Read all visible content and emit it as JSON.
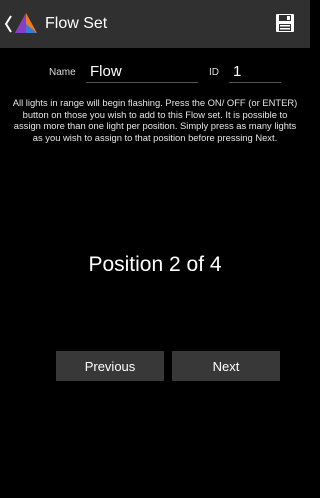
{
  "app_bar": {
    "title": "Flow Set",
    "back_icon": "chevron-left-icon",
    "logo_icon": "app-logo-icon",
    "save_icon": "save-icon"
  },
  "form": {
    "name_label": "Name",
    "name_value": "Flow",
    "id_label": "ID",
    "id_value": "1"
  },
  "instructions": "All lights in range will begin flashing. Press the ON/ OFF (or ENTER) button on those you wish to add to this Flow set. It is possible to assign more than one light per position. Simply press as many lights as you wish to assign to that position before pressing Next.",
  "position_text": "Position 2 of 4",
  "buttons": {
    "previous": "Previous",
    "next": "Next"
  },
  "colors": {
    "background": "#000000",
    "app_bar": "#303030",
    "button": "#383838",
    "logo_orange": "#f07a22",
    "logo_purple": "#8a3cc6",
    "logo_blue": "#3a7bd5"
  }
}
